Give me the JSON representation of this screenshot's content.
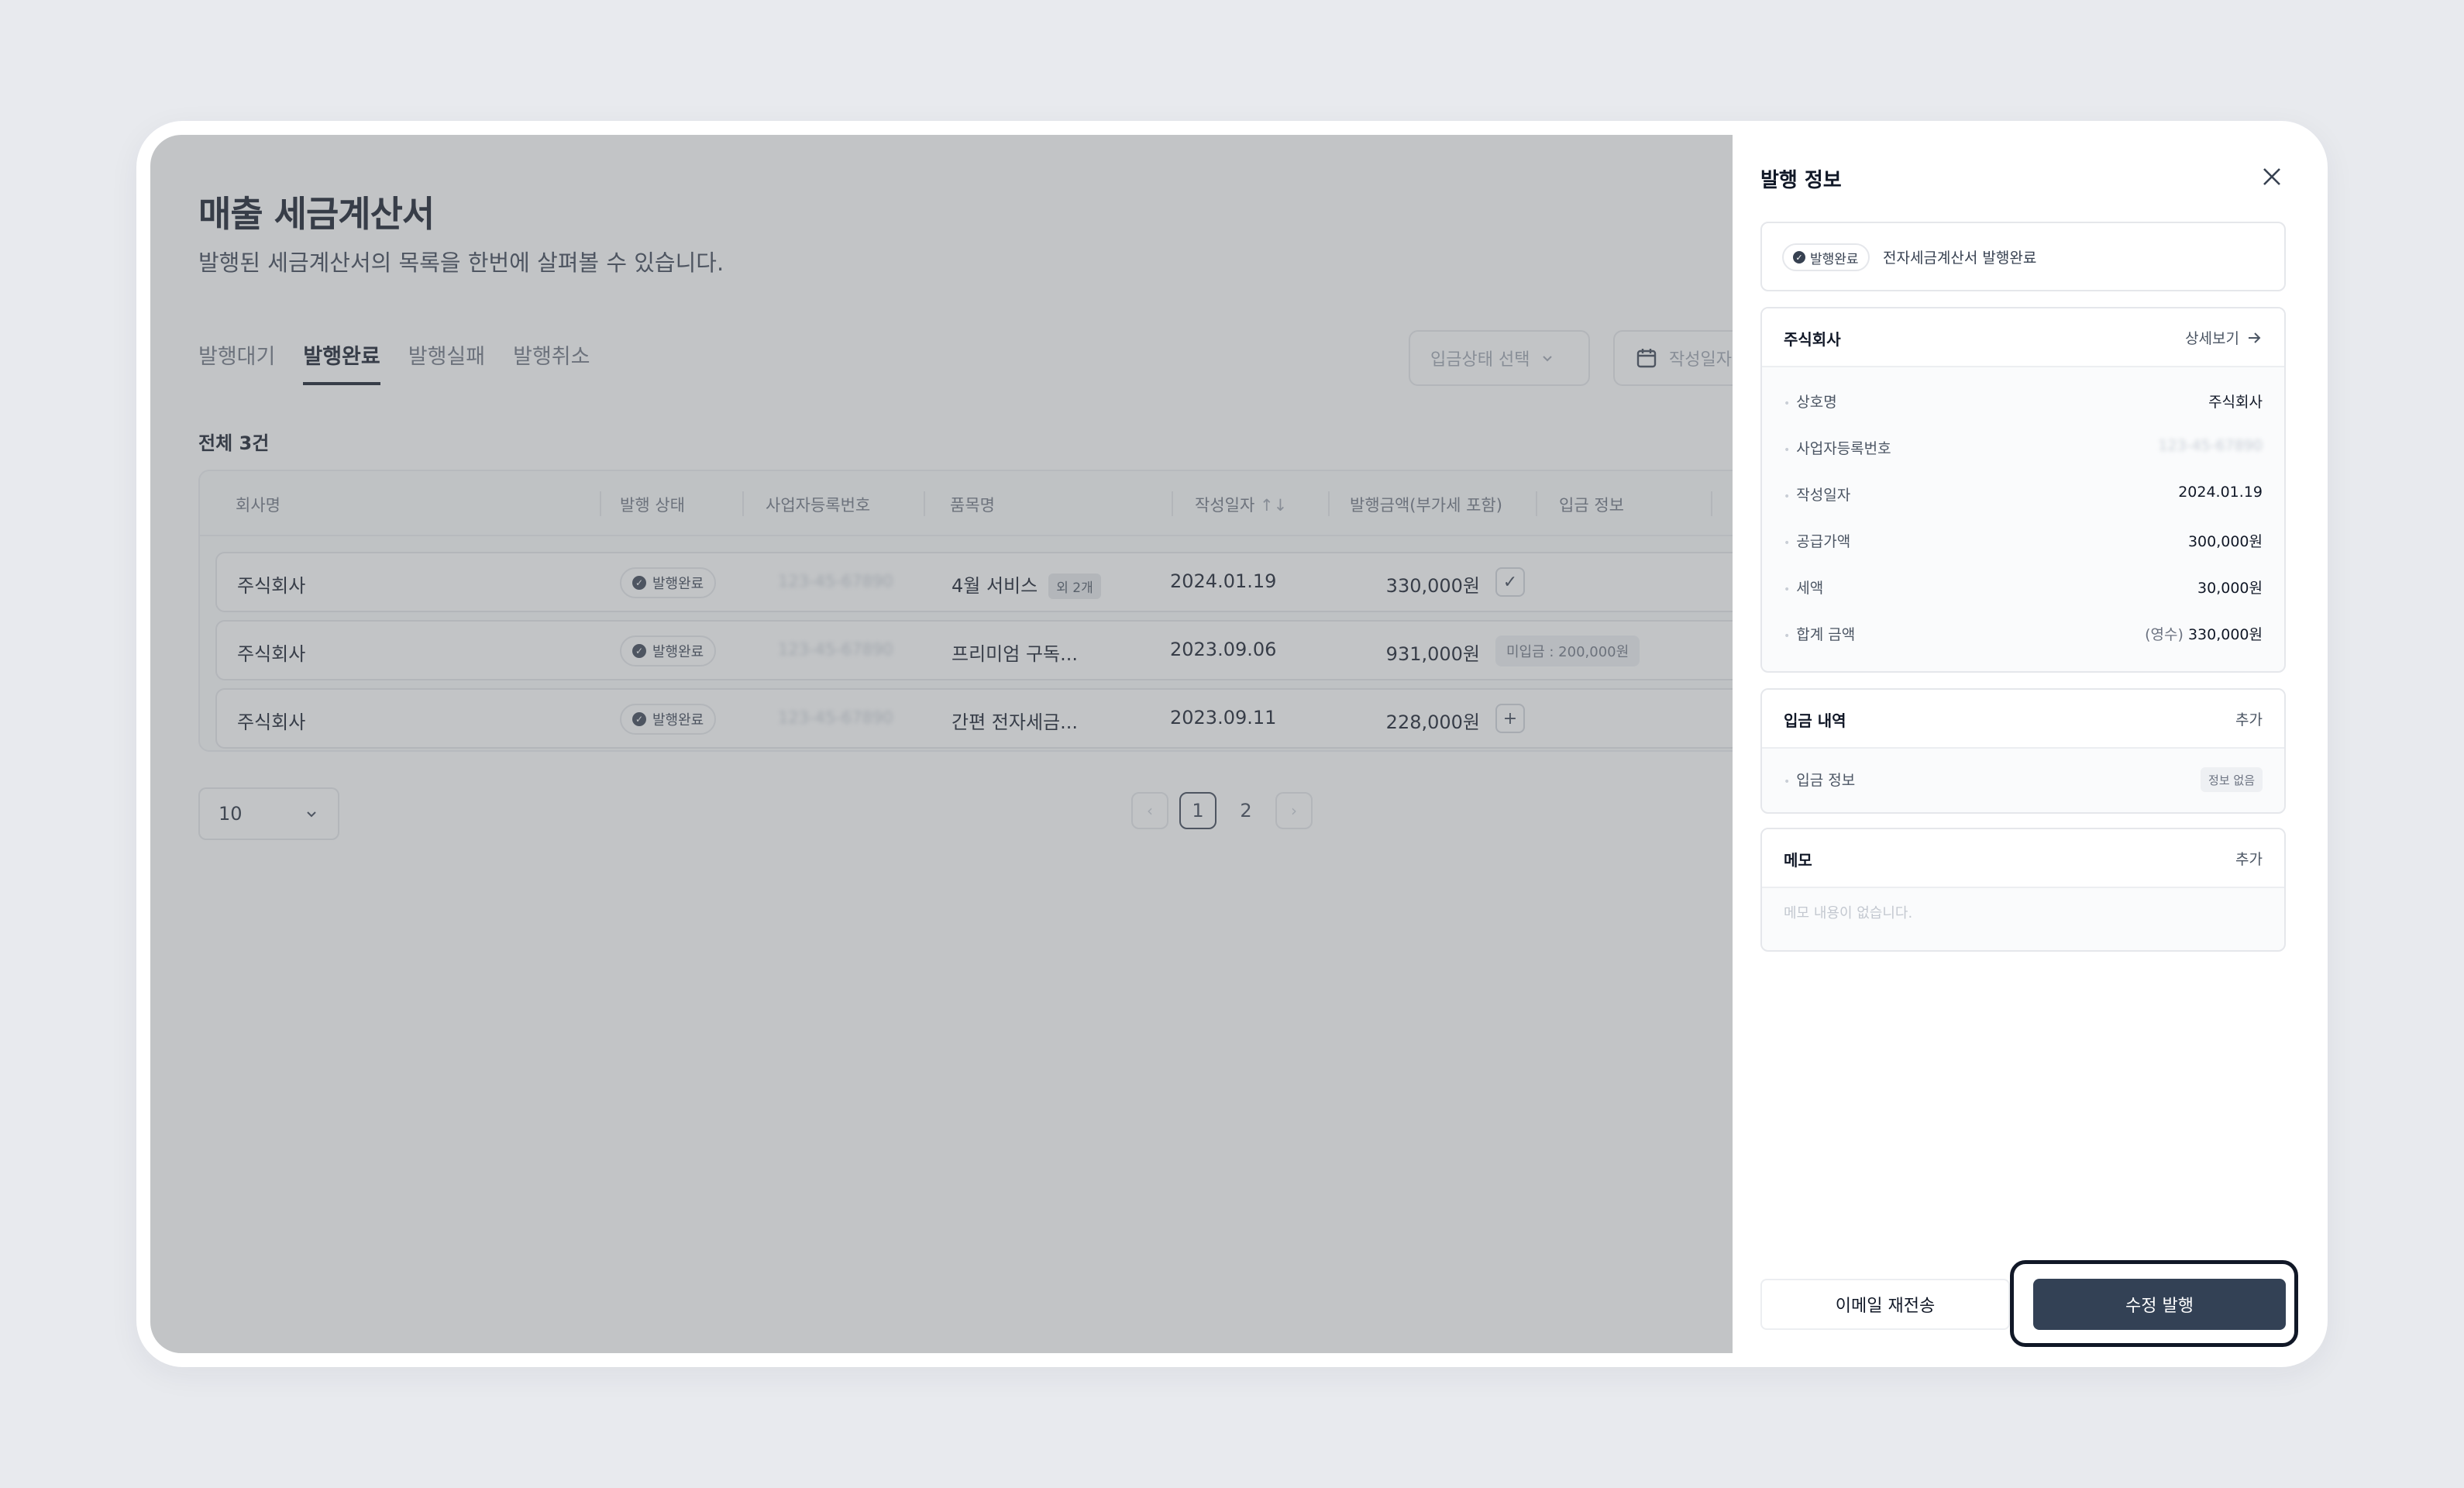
{
  "page": {
    "title": "매출 세금계산서",
    "subtitle": "발행된 세금계산서의 목록을 한번에 살펴볼 수 있습니다."
  },
  "tabs": [
    "발행대기",
    "발행완료",
    "발행실패",
    "발행취소"
  ],
  "filters": {
    "deposit_status_placeholder": "입금상태 선택",
    "date_placeholder": "작성일자"
  },
  "total": "전체 3건",
  "table": {
    "headers": [
      "회사명",
      "발행 상태",
      "사업자등록번호",
      "품목명",
      "작성일자",
      "발행금액(부가세 포함)",
      "입금 정보"
    ],
    "sort_icon": "↑↓",
    "rows": [
      {
        "company": "주식회사",
        "status": "발행완료",
        "biz_no": "123-45-67890",
        "item": "4월 서비스",
        "item_extra": "외 2개",
        "date": "2024.01.19",
        "amount": "330,000원",
        "payment": "check"
      },
      {
        "company": "주식회사",
        "status": "발행완료",
        "biz_no": "123-45-67890",
        "item": "프리미엄 구독...",
        "item_extra": "",
        "date": "2023.09.06",
        "amount": "931,000원",
        "payment": "미입금 : 200,000원"
      },
      {
        "company": "주식회사",
        "status": "발행완료",
        "biz_no": "123-45-67890",
        "item": "간편 전자세금...",
        "item_extra": "",
        "date": "2023.09.11",
        "amount": "228,000원",
        "payment": "add"
      }
    ]
  },
  "pagination": {
    "page_size": "10",
    "pages": [
      "1",
      "2"
    ],
    "current": "1"
  },
  "panel": {
    "title": "발행 정보",
    "status_badge": "발행완료",
    "status_text": "전자세금계산서 발행완료",
    "company_card": {
      "title": "주식회사",
      "detail_link": "상세보기",
      "fields": [
        {
          "label": "상호명",
          "value": "주식회사"
        },
        {
          "label": "사업자등록번호",
          "value": "123-45-67890"
        },
        {
          "label": "작성일자",
          "value": "2024.01.19"
        },
        {
          "label": "공급가액",
          "value": "300,000원"
        },
        {
          "label": "세액",
          "value": "30,000원"
        },
        {
          "label": "합계 금액",
          "prefix": "(영수)",
          "value": "330,000원"
        }
      ]
    },
    "deposit_card": {
      "title": "입금 내역",
      "add": "추가",
      "label": "입금 정보",
      "value": "정보 없음"
    },
    "memo_card": {
      "title": "메모",
      "add": "추가",
      "empty": "메모 내용이 없습니다."
    },
    "email_button": "이메일 재전송",
    "edit_button": "수정 발행"
  }
}
